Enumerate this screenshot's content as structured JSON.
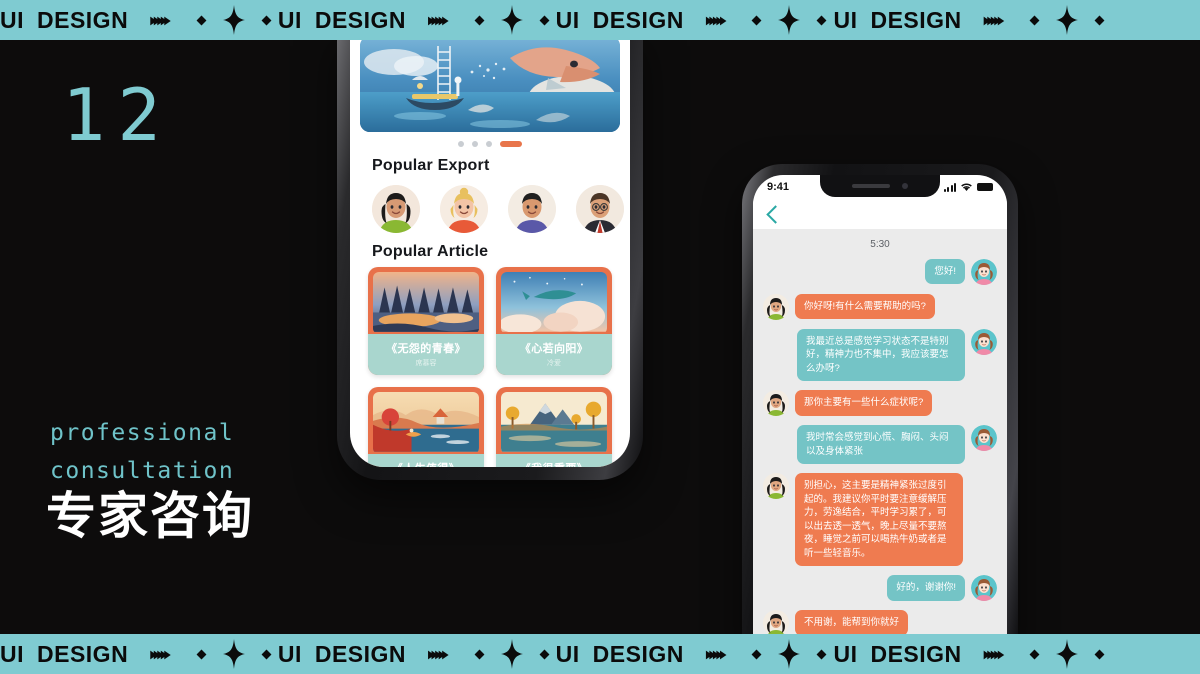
{
  "banner": {
    "word1": "UI",
    "word2": "DESIGN",
    "arrows": "▸▸▸▸▸",
    "diamond_icon": "diamond-icon",
    "star_icon": "four-point-star-icon",
    "repeats": 4
  },
  "left_panel": {
    "page_number": "12",
    "kicker_line1": "professional",
    "kicker_line2": "consultation",
    "headline": "专家咨询"
  },
  "phone_left": {
    "carousel": {
      "alt": "whale-in-clouds-illustration",
      "dots": 4,
      "active_dot": 4
    },
    "sections": [
      {
        "title": "Popular Export"
      },
      {
        "title": "Popular Article"
      }
    ],
    "experts": [
      {
        "name": "expert-avatar-1",
        "hair": "#1d1b1a",
        "shirt": "#8ab833",
        "skin": "#d79a74",
        "bg": "#f3e7dc"
      },
      {
        "name": "expert-avatar-2",
        "hair": "#e8c05e",
        "shirt": "#e85a38",
        "skin": "#f3c4a6",
        "bg": "#f6ece2"
      },
      {
        "name": "expert-avatar-3",
        "hair": "#20201f",
        "shirt": "#5a58a8",
        "skin": "#d9996f",
        "bg": "#f3ece3"
      },
      {
        "name": "expert-avatar-4",
        "hair": "#4a3526",
        "shirt": "#2b2b33",
        "skin": "#dba078",
        "bg": "#f2e9df"
      }
    ],
    "articles": [
      {
        "title": "《无怨的青春》",
        "author": "席慕容",
        "art": "forest-dusk"
      },
      {
        "title": "《心若向阳》",
        "author": "冷爱",
        "art": "whale-sky"
      },
      {
        "title": "《人生值得》",
        "author": "",
        "art": "riverside-autumn"
      },
      {
        "title": "《我很重要》",
        "author": "",
        "art": "mountain-lake"
      }
    ]
  },
  "phone_right": {
    "status": {
      "time": "9:41",
      "signal_icon": "signal-bars-icon",
      "wifi_icon": "wifi-icon",
      "battery_icon": "battery-icon"
    },
    "nav": {
      "back_icon": "back-chevron-icon"
    },
    "chat_time": "5:30",
    "messages": [
      {
        "from": "me",
        "text": "您好!"
      },
      {
        "from": "them",
        "text": "你好呀!有什么需要帮助的吗?"
      },
      {
        "from": "me",
        "text": "我最近总是感觉学习状态不是特别好，精神力也不集中，我应该要怎么办呀?"
      },
      {
        "from": "them",
        "text": "那你主要有一些什么症状呢?"
      },
      {
        "from": "me",
        "text": "我时常会感觉到心慌、胸闷、头闷以及身体紧张"
      },
      {
        "from": "them",
        "text": "别担心，这主要是精神紧张过度引起的。我建议你平时要注意缓解压力，劳逸结合，平时学习累了，可以出去透一透气，晚上尽量不要熬夜，睡觉之前可以喝热牛奶或者是听一些轻音乐。"
      },
      {
        "from": "me",
        "text": "好的，谢谢你!"
      },
      {
        "from": "them",
        "text": "不用谢，能帮到你就好"
      }
    ],
    "avatars": {
      "me": "user-avatar-girl",
      "them": "counselor-avatar-woman"
    }
  },
  "colors": {
    "teal_banner": "#7fcbd1",
    "background": "#0d0c0c",
    "accent_orange": "#ef7b50",
    "accent_teal": "#74c4c6",
    "headline_white": "#ffffff",
    "kicker_teal": "#6fc3c9"
  }
}
